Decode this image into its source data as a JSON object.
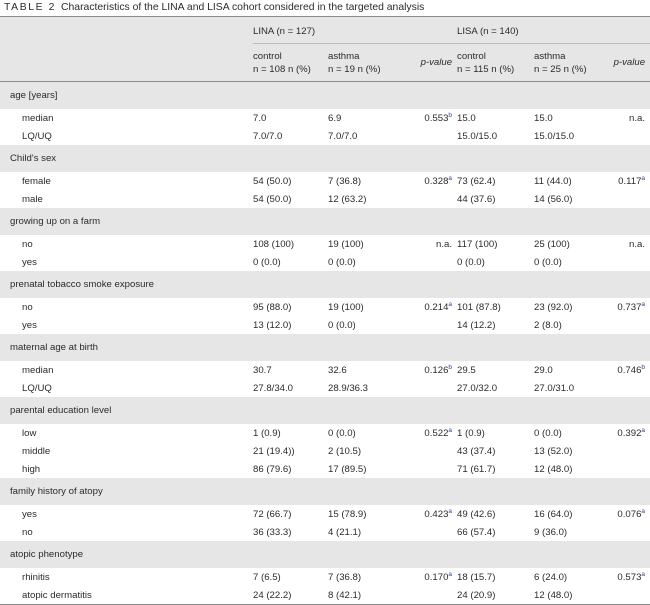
{
  "caption": {
    "label": "TABLE 2",
    "title": "Characteristics of the LINA and LISA cohort considered in the targeted analysis"
  },
  "header": {
    "lina": "LINA (n = 127)",
    "lisa": "LISA (n = 140)",
    "lina_cols": [
      {
        "l1": "control",
        "l2": "n = 108 n (%)"
      },
      {
        "l1": "asthma",
        "l2": "n = 19 n (%)"
      },
      {
        "l1": "p-value",
        "l2": ""
      }
    ],
    "lisa_cols": [
      {
        "l1": "control",
        "l2": "n = 115 n (%)"
      },
      {
        "l1": "asthma",
        "l2": "n = 25 n (%)"
      },
      {
        "l1": "p-value",
        "l2": ""
      }
    ]
  },
  "sections": [
    {
      "title": "age [years]",
      "rows": [
        {
          "label": "median",
          "c1": "7.0",
          "c2": "6.9",
          "p1": "0.553",
          "s1": "b",
          "c4": "15.0",
          "c5": "15.0",
          "p2": "n.a.",
          "s2": ""
        },
        {
          "label": "LQ/UQ",
          "c1": "7.0/7.0",
          "c2": "7.0/7.0",
          "p1": "",
          "s1": "",
          "c4": "15.0/15.0",
          "c5": "15.0/15.0",
          "p2": "",
          "s2": ""
        }
      ]
    },
    {
      "title": "Child's sex",
      "rows": [
        {
          "label": "female",
          "c1": "54 (50.0)",
          "c2": "7 (36.8)",
          "p1": "0.328",
          "s1": "a",
          "c4": "73 (62.4)",
          "c5": "11 (44.0)",
          "p2": "0.117",
          "s2": "a"
        },
        {
          "label": "male",
          "c1": "54 (50.0)",
          "c2": "12 (63.2)",
          "p1": "",
          "s1": "",
          "c4": "44 (37.6)",
          "c5": "14 (56.0)",
          "p2": "",
          "s2": ""
        }
      ]
    },
    {
      "title": "growing up on a farm",
      "rows": [
        {
          "label": "no",
          "c1": "108 (100)",
          "c2": "19 (100)",
          "p1": "n.a.",
          "s1": "",
          "c4": "117 (100)",
          "c5": "25 (100)",
          "p2": "n.a.",
          "s2": ""
        },
        {
          "label": "yes",
          "c1": "0 (0.0)",
          "c2": "0 (0.0)",
          "p1": "",
          "s1": "",
          "c4": "0 (0.0)",
          "c5": "0 (0.0)",
          "p2": "",
          "s2": ""
        }
      ]
    },
    {
      "title": "prenatal tobacco smoke exposure",
      "rows": [
        {
          "label": "no",
          "c1": "95 (88.0)",
          "c2": "19 (100)",
          "p1": "0.214",
          "s1": "a",
          "c4": "101 (87.8)",
          "c5": "23 (92.0)",
          "p2": "0.737",
          "s2": "a"
        },
        {
          "label": "yes",
          "c1": "13 (12.0)",
          "c2": "0 (0.0)",
          "p1": "",
          "s1": "",
          "c4": "14 (12.2)",
          "c5": "2 (8.0)",
          "p2": "",
          "s2": ""
        }
      ]
    },
    {
      "title": "maternal age at birth",
      "rows": [
        {
          "label": "median",
          "c1": "30.7",
          "c2": "32.6",
          "p1": "0.126",
          "s1": "b",
          "c4": "29.5",
          "c5": "29.0",
          "p2": "0.746",
          "s2": "b"
        },
        {
          "label": "LQ/UQ",
          "c1": "27.8/34.0",
          "c2": "28.9/36.3",
          "p1": "",
          "s1": "",
          "c4": "27.0/32.0",
          "c5": "27.0/31.0",
          "p2": "",
          "s2": ""
        }
      ]
    },
    {
      "title": "parental education level",
      "rows": [
        {
          "label": "low",
          "c1": "1 (0.9)",
          "c2": "0 (0.0)",
          "p1": "0.522",
          "s1": "a",
          "c4": "1 (0.9)",
          "c5": "0 (0.0)",
          "p2": "0.392",
          "s2": "a"
        },
        {
          "label": "middle",
          "c1": "21 (19.4))",
          "c2": "2 (10.5)",
          "p1": "",
          "s1": "",
          "c4": "43 (37.4)",
          "c5": "13 (52.0)",
          "p2": "",
          "s2": ""
        },
        {
          "label": "high",
          "c1": "86 (79.6)",
          "c2": "17 (89.5)",
          "p1": "",
          "s1": "",
          "c4": "71 (61.7)",
          "c5": "12 (48.0)",
          "p2": "",
          "s2": ""
        }
      ]
    },
    {
      "title": "family history of atopy",
      "rows": [
        {
          "label": "yes",
          "c1": "72 (66.7)",
          "c2": "15 (78.9)",
          "p1": "0.423",
          "s1": "a",
          "c4": "49 (42.6)",
          "c5": "16 (64.0)",
          "p2": "0.076",
          "s2": "a"
        },
        {
          "label": "no",
          "c1": "36 (33.3)",
          "c2": "4 (21.1)",
          "p1": "",
          "s1": "",
          "c4": "66 (57.4)",
          "c5": "9 (36.0)",
          "p2": "",
          "s2": ""
        }
      ]
    },
    {
      "title": "atopic phenotype",
      "rows": [
        {
          "label": "rhinitis",
          "c1": "7 (6.5)",
          "c2": "7 (36.8)",
          "p1": "0.170",
          "s1": "a",
          "c4": "18 (15.7)",
          "c5": "6 (24.0)",
          "p2": "0.573",
          "s2": "a"
        },
        {
          "label": "atopic dermatitis",
          "c1": "24 (22.2)",
          "c2": "8 (42.1)",
          "p1": "",
          "s1": "",
          "c4": "24 (20.9)",
          "c5": "12 (48.0)",
          "p2": "",
          "s2": ""
        }
      ]
    }
  ]
}
